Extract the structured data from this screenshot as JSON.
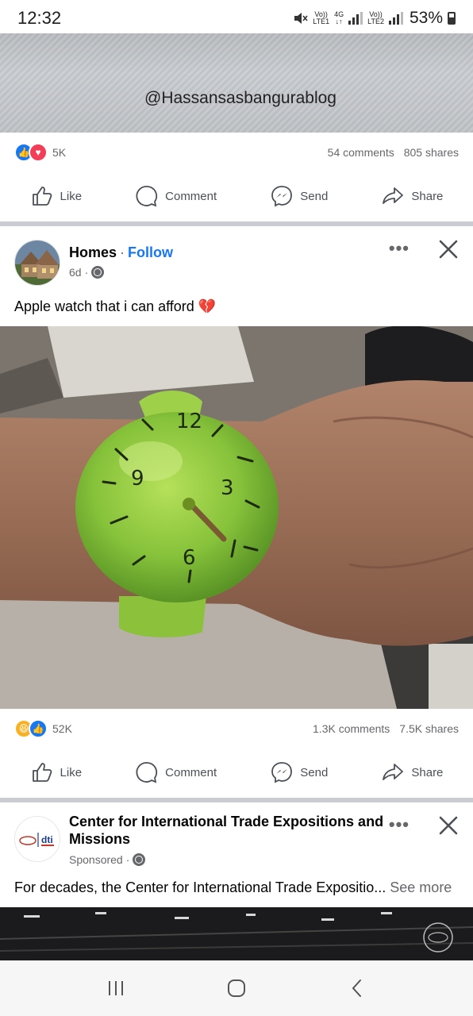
{
  "status_bar": {
    "time": "12:32",
    "sim1_top": "Vo))",
    "sim1_bottom": "LTE1",
    "net": "4G",
    "sim2_top": "Vo))",
    "sim2_bottom": "LTE2",
    "battery_percent": "53%"
  },
  "previous_post": {
    "watermark": "@Hassansasbangurablog",
    "reaction_count": "5K",
    "reactions": [
      "like-icon",
      "love-icon"
    ],
    "comments": "54 comments",
    "shares": "805 shares"
  },
  "actions": {
    "like": "Like",
    "comment": "Comment",
    "send": "Send",
    "share": "Share"
  },
  "post": {
    "page_name": "Homes",
    "separator": "·",
    "follow_label": "Follow",
    "time": "6d",
    "meta_separator": "·",
    "text": "Apple watch that i can afford 💔",
    "reaction_count": "52K",
    "reactions": [
      "haha-icon",
      "like-icon"
    ],
    "comments": "1.3K comments",
    "shares": "7.5K shares",
    "image_clock_numbers": [
      "12",
      "3",
      "6",
      "9"
    ]
  },
  "sponsored_post": {
    "name": "Center for International Trade Expositions and Missions",
    "label": "Sponsored",
    "meta_separator": "·",
    "text": "For decades, the Center for International Trade Expositio...",
    "see_more": "See more",
    "logo_text": "dti"
  },
  "colors": {
    "accent": "#1877f2",
    "secondary_text": "#65676b",
    "divider": "#c9ccd1"
  }
}
